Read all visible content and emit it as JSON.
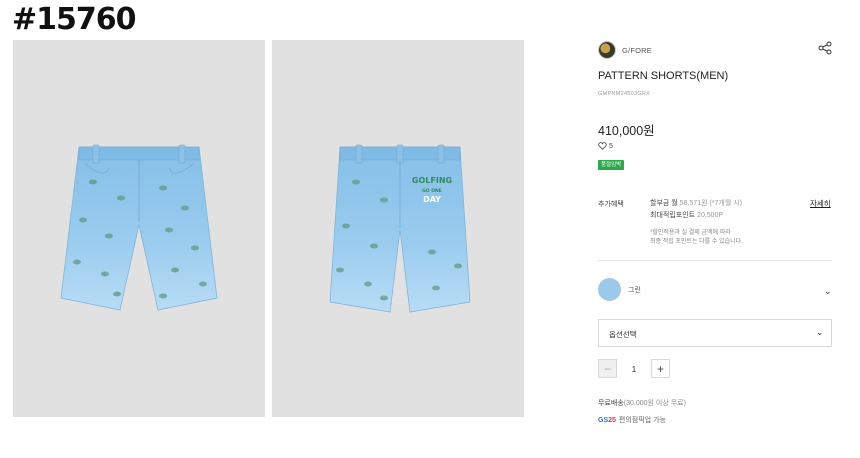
{
  "tag": "#15760",
  "product": {
    "brand": "G/FORE",
    "title": "PATTERN SHORTS(MEN)",
    "sku": "GMPNM24503GRX",
    "price": "410,000원",
    "likes": "5",
    "badge": "품절임박"
  },
  "benefits": {
    "label": "추가혜택",
    "installment_a": "할부금 월",
    "installment_b": "58,571원 (*7개월 시)",
    "points_a": "최대적립포인트",
    "points_b": "20,500P",
    "detail_link": "자세히",
    "note_1": "*할인적용과 실 결제 금액에 따라",
    "note_2": "최종 적립 포인트는 다를 수 있습니다."
  },
  "color_option": {
    "name": "그린",
    "swatch": "#9cc9ea"
  },
  "option_select": {
    "label": "옵션선택"
  },
  "quantity": {
    "minus": "−",
    "value": "1",
    "plus": "+"
  },
  "shipping": {
    "main": "무료배송",
    "detail": "(30,000원 이상 무료)"
  },
  "pickup": {
    "logo_a": "GS",
    "logo_b": "25",
    "text": "편의점픽업 가능"
  },
  "images": {
    "front_alt": "front",
    "back_alt": "back",
    "patch_1": "GOLFING",
    "patch_2": "GO ONE",
    "patch_3": "DAY"
  },
  "icons": {
    "share": "share-icon",
    "heart": "heart-icon",
    "chevron": "chevron-down-icon"
  },
  "colors": {
    "accent_green": "#2aa84a",
    "image_bg": "#e1e1e1",
    "shorts_top": "#8cc3e8",
    "shorts_bottom": "#b9dcf3"
  }
}
